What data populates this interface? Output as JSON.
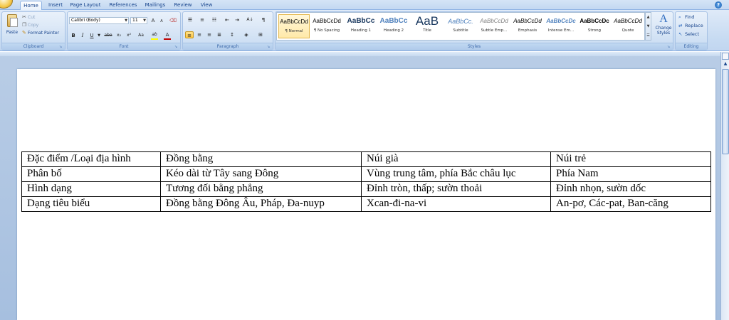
{
  "tabs": [
    "Home",
    "Insert",
    "Page Layout",
    "References",
    "Mailings",
    "Review",
    "View"
  ],
  "active_tab": "Home",
  "clipboard": {
    "group_label": "Clipboard",
    "paste": "Paste",
    "cut": "Cut",
    "copy": "Copy",
    "format_painter": "Format Painter"
  },
  "font": {
    "group_label": "Font",
    "font_name": "Calibri (Body)",
    "font_size": "11",
    "bold": "B",
    "italic": "I",
    "underline": "U",
    "strike": "abe",
    "subscript": "x₂",
    "superscript": "x²",
    "change_case": "Aa",
    "grow": "A",
    "shrink": "A",
    "highlight": "ab",
    "font_color": "A",
    "highlight_color": "#ffff00",
    "font_color_value": "#c00000"
  },
  "paragraph": {
    "group_label": "Paragraph"
  },
  "styles": {
    "group_label": "Styles",
    "items": [
      {
        "sample": "AaBbCcDd",
        "name": "¶ Normal"
      },
      {
        "sample": "AaBbCcDd",
        "name": "¶ No Spacing"
      },
      {
        "sample": "AaBbCc",
        "name": "Heading 1"
      },
      {
        "sample": "AaBbCc",
        "name": "Heading 2"
      },
      {
        "sample": "AaB",
        "name": "Title"
      },
      {
        "sample": "AaBbCc.",
        "name": "Subtitle"
      },
      {
        "sample": "AaBbCcDd",
        "name": "Subtle Emp..."
      },
      {
        "sample": "AaBbCcDd",
        "name": "Emphasis"
      },
      {
        "sample": "AaBbCcDc",
        "name": "Intense Em..."
      },
      {
        "sample": "AaBbCcDc",
        "name": "Strong"
      },
      {
        "sample": "AaBbCcDd",
        "name": "Quote"
      }
    ],
    "change_styles": "Change Styles"
  },
  "editing": {
    "group_label": "Editing",
    "find": "Find",
    "replace": "Replace",
    "select": "Select"
  },
  "table": {
    "rows": [
      [
        "Đặc điểm /Loại địa hình",
        "Đồng bằng",
        "Núi già",
        "Núi trẻ"
      ],
      [
        "Phân bố",
        "Kéo dài từ Tây sang Đông",
        "Vùng trung tâm, phía Bắc châu lục",
        "Phía Nam"
      ],
      [
        "Hình dạng",
        "Tương đối bằng phẳng",
        "Đỉnh tròn, thấp; sườn thoải",
        "Đỉnh nhọn, sườn dốc"
      ],
      [
        "Dạng tiêu biểu",
        "Đồng bằng Đông Âu, Pháp, Đa-nuyp",
        "Xcan-đi-na-vi",
        "An-pơ, Các-pat, Ban-căng"
      ]
    ]
  }
}
